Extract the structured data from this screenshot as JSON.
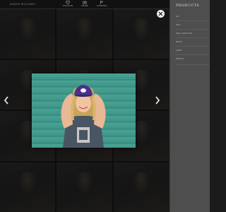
{
  "topbar": {
    "owner": "DAVID MICHAEL",
    "actions": [
      {
        "label": "FAVORITE",
        "icon": "heart-icon"
      },
      {
        "label": "SHARE",
        "icon": "share-icon"
      },
      {
        "label": "COMPARE",
        "icon": "flag-icon"
      }
    ]
  },
  "products": {
    "title": "PRODUCTS",
    "items": [
      "ALL",
      "GIFT",
      "WALL DISPLAYS",
      "BOOK",
      "CARD",
      "PRINTS"
    ]
  },
  "lightbox": {
    "close_icon": "close-icon",
    "prev_icon": "chevron-left-icon",
    "next_icon": "chevron-right-icon",
    "photo_description": "Senior girl in purple cap on teal wood wall"
  },
  "colors": {
    "panel": "#4e4e4e",
    "backdrop": "#1b1b1b",
    "teal_wall": "#3f9486",
    "cap_purple": "#4a2f8c"
  }
}
